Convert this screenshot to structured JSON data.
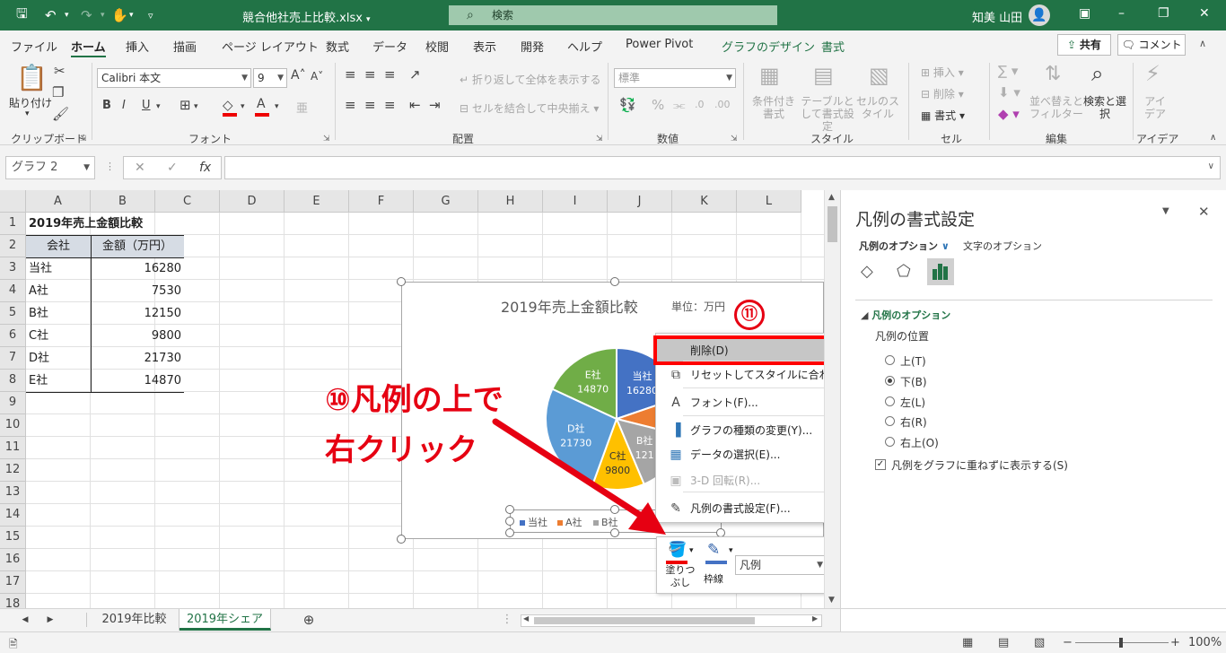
{
  "window": {
    "title": "競合他社売上比較.xlsx",
    "search_placeholder": "検索",
    "user": "知美 山田"
  },
  "ribbon_tabs": [
    "ファイル",
    "ホーム",
    "挿入",
    "描画",
    "ページ レイアウト",
    "数式",
    "データ",
    "校閲",
    "表示",
    "開発",
    "ヘルプ",
    "Power Pivot",
    "グラフのデザイン",
    "書式"
  ],
  "ribbon_buttons": {
    "share": "共有",
    "comment": "コメント"
  },
  "ribbon": {
    "clipboard": {
      "label": "クリップボード",
      "paste": "貼り付け"
    },
    "font": {
      "label": "フォント",
      "name": "Calibri 本文",
      "size": "9"
    },
    "alignment": {
      "label": "配置",
      "wrap": "折り返して全体を表示する",
      "merge": "セルを結合して中央揃え"
    },
    "number": {
      "label": "数値",
      "format": "標準"
    },
    "styles": {
      "label": "スタイル",
      "conditional": "条件付き書式",
      "table": "テーブルとして書式設定",
      "cell": "セルのスタイル"
    },
    "cells": {
      "label": "セル",
      "insert": "挿入",
      "delete": "削除",
      "format": "書式"
    },
    "editing": {
      "label": "編集",
      "sort": "並べ替えとフィルター",
      "find": "検索と選択"
    },
    "ideas": {
      "label": "アイデア",
      "ideas": "アイデア"
    }
  },
  "formula_bar": {
    "name_box": "グラフ 2",
    "fx": "fx"
  },
  "columns": [
    "A",
    "B",
    "C",
    "D",
    "E",
    "F",
    "G",
    "H",
    "I",
    "J",
    "K",
    "L"
  ],
  "rows": [
    "1",
    "2",
    "3",
    "4",
    "5",
    "6",
    "7",
    "8",
    "9",
    "10",
    "11",
    "12",
    "13",
    "14",
    "15",
    "16",
    "17",
    "18"
  ],
  "sheet": {
    "title": "2019年売上金額比較",
    "headers": [
      "会社",
      "金額（万円）"
    ],
    "data": [
      {
        "company": "当社",
        "amount": "16280"
      },
      {
        "company": "A社",
        "amount": "7530"
      },
      {
        "company": "B社",
        "amount": "12150"
      },
      {
        "company": "C社",
        "amount": "9800"
      },
      {
        "company": "D社",
        "amount": "21730"
      },
      {
        "company": "E社",
        "amount": "14870"
      }
    ]
  },
  "chart_data": {
    "type": "pie",
    "title": "2019年売上金額比較",
    "unit": "単位：万円",
    "categories": [
      "当社",
      "A社",
      "B社",
      "C社",
      "D社",
      "E社"
    ],
    "values": [
      16280,
      7530,
      12150,
      9800,
      21730,
      14870
    ],
    "colors": [
      "#4472c4",
      "#ed7d31",
      "#a5a5a5",
      "#ffc000",
      "#5b9bd5",
      "#70ad47"
    ],
    "visible_slice_labels": [
      {
        "name": "当社",
        "value": "16280"
      },
      {
        "name": "B社",
        "value": "121"
      },
      {
        "name": "C社",
        "value": "9800"
      },
      {
        "name": "D社",
        "value": "21730"
      },
      {
        "name": "E社",
        "value": "14870"
      }
    ],
    "visible_legend": [
      "当社",
      "A社",
      "B社"
    ],
    "legend": "bottom"
  },
  "context_menu": [
    {
      "label": "削除(D)",
      "icon": "none",
      "state": "selected"
    },
    {
      "label": "リセットしてスタイルに合わせる(A)",
      "icon": "reset-style-icon",
      "state": "normal"
    },
    {
      "label": "フォント(F)...",
      "icon": "font-icon",
      "state": "normal"
    },
    {
      "label": "グラフの種類の変更(Y)...",
      "icon": "chart-type-icon",
      "state": "normal"
    },
    {
      "label": "データの選択(E)...",
      "icon": "select-data-icon",
      "state": "normal"
    },
    {
      "label": "3-D 回転(R)...",
      "icon": "3d-rotation-icon",
      "state": "disabled"
    },
    {
      "label": "凡例の書式設定(F)...",
      "icon": "format-legend-icon",
      "state": "normal"
    }
  ],
  "mini_toolbar": {
    "fill": "塗りつぶし",
    "outline": "枠線",
    "element": "凡例"
  },
  "annotations": {
    "step10_line1": "⑩凡例の上で",
    "step10_line2": "右クリック",
    "step11": "⑪",
    "color": "#e60012"
  },
  "format_pane": {
    "title": "凡例の書式設定",
    "tab_legend": "凡例のオプション",
    "tab_text": "文字のオプション",
    "section": "凡例のオプション",
    "position_label": "凡例の位置",
    "positions": [
      {
        "label": "上(T)",
        "checked": false
      },
      {
        "label": "下(B)",
        "checked": true
      },
      {
        "label": "左(L)",
        "checked": false
      },
      {
        "label": "右(R)",
        "checked": false
      },
      {
        "label": "右上(O)",
        "checked": false
      }
    ],
    "overlap": {
      "label": "凡例をグラフに重ねずに表示する(S)",
      "checked": true
    }
  },
  "sheet_tabs": [
    {
      "label": "2019年比較",
      "active": false
    },
    {
      "label": "2019年シェア",
      "active": true
    }
  ],
  "status": {
    "zoom": "100%"
  }
}
